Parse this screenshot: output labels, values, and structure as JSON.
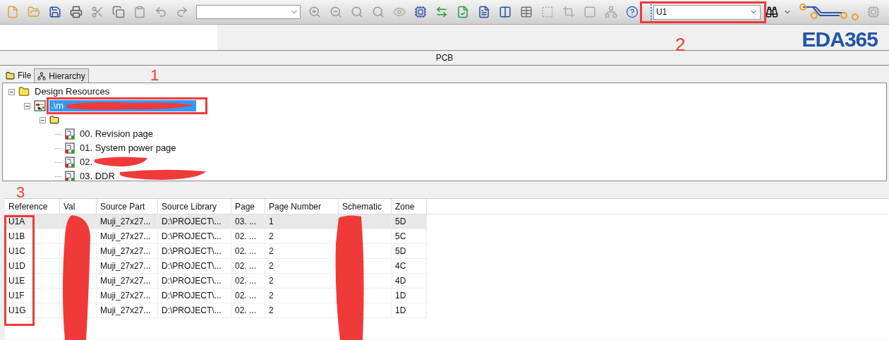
{
  "toolbar": {
    "part_search": {
      "value": "U1"
    }
  },
  "logo": "EDA365",
  "panel_title": "PCB",
  "tabs": [
    {
      "label": "File",
      "selected": true
    },
    {
      "label": "Hierarchy",
      "selected": false
    }
  ],
  "tree": [
    {
      "label": "Design Resources",
      "kind": "folder",
      "expanded": true,
      "selected": false,
      "children": [
        {
          "label": ".\\m",
          "kind": "design",
          "expanded": true,
          "selected": true,
          "children": [
            {
              "kind": "schematic-folder",
              "expanded": true,
              "children": [
                {
                  "label": "00. Revision page",
                  "kind": "page",
                  "selected": false
                },
                {
                  "label": "01. System power page",
                  "kind": "page",
                  "selected": false
                },
                {
                  "label": "02.",
                  "kind": "page",
                  "selected": false
                },
                {
                  "label": "03. DDR",
                  "kind": "page",
                  "selected": false
                }
              ]
            }
          ]
        }
      ]
    }
  ],
  "table": {
    "columns": [
      "Reference",
      "Val",
      "Source Part",
      "Source Library",
      "Page",
      "Page Number",
      "Schematic",
      "Zone"
    ],
    "rows": [
      {
        "reference": "U1A",
        "source_part": "Muji_27x27...",
        "source_library": "D:\\PROJECT\\...",
        "page": "03. ...",
        "page_number": "1",
        "zone": "5D",
        "selected": true
      },
      {
        "reference": "U1B",
        "source_part": "Muji_27x27...",
        "source_library": "D:\\PROJECT\\...",
        "page": "02. ...",
        "page_number": "2",
        "zone": "5C",
        "selected": false
      },
      {
        "reference": "U1C",
        "source_part": "Muji_27x27...",
        "source_library": "D:\\PROJECT\\...",
        "page": "02. ...",
        "page_number": "2",
        "zone": "5D",
        "selected": false
      },
      {
        "reference": "U1D",
        "source_part": "Muji_27x27...",
        "source_library": "D:\\PROJECT\\...",
        "page": "02. ...",
        "page_number": "2",
        "zone": "4C",
        "selected": false
      },
      {
        "reference": "U1E",
        "source_part": "Muji_27x27...",
        "source_library": "D:\\PROJECT\\...",
        "page": "02. ...",
        "page_number": "2",
        "zone": "4D",
        "selected": false
      },
      {
        "reference": "U1F",
        "source_part": "Muji_27x27...",
        "source_library": "D:\\PROJECT\\...",
        "page": "02. ...",
        "page_number": "2",
        "zone": "1D",
        "selected": false
      },
      {
        "reference": "U1G",
        "source_part": "Muji_27x27...",
        "source_library": "D:\\PROJECT\\...",
        "page": "02. ...",
        "page_number": "2",
        "zone": "1D",
        "selected": false
      }
    ]
  },
  "annotations": [
    {
      "label": "1"
    },
    {
      "label": "2"
    },
    {
      "label": "3"
    }
  ]
}
